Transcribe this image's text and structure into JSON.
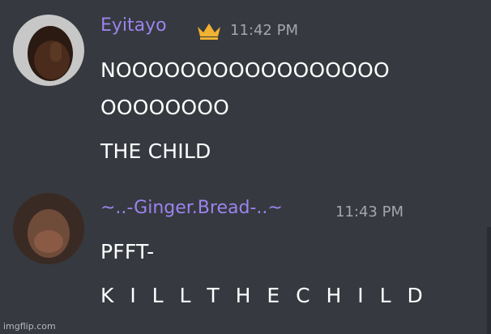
{
  "messages": [
    {
      "username": "Eyitayo",
      "badge_icon": "crown-icon",
      "timestamp": "11:42 PM",
      "lines": [
        "NOOOOOOOOOOOOOOOOO",
        "OOOOOOOO"
      ],
      "follow_up": "THE CHILD"
    },
    {
      "username": "~..-Ginger.Bread-..~",
      "timestamp": "11:43 PM",
      "line": "PFFT-",
      "follow_up": "K I L L T H E C H I L D"
    }
  ],
  "watermark": "imgflip.com",
  "colors": {
    "background": "#36393f",
    "username": "#9b84ee",
    "timestamp": "#a3a6ab",
    "message_text": "#ffffff",
    "crown": "#f0b232"
  }
}
